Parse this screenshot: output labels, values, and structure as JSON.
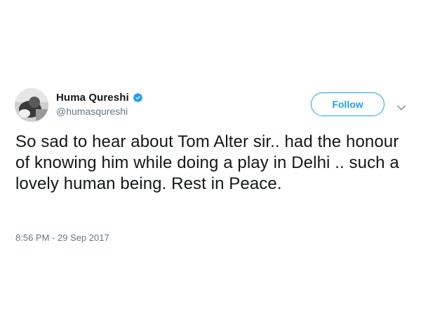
{
  "user": {
    "display_name": "Huma Qureshi",
    "handle": "@humasqureshi",
    "verified_icon": "verified-badge-icon",
    "avatar_icon": "profile-photo"
  },
  "follow_button": {
    "label": "Follow"
  },
  "menu_icon": "chevron-down-icon",
  "tweet": {
    "text": "So sad to hear about Tom Alter sir.. had the honour of knowing him while doing a play in Delhi .. such a lovely human being. Rest in Peace.",
    "timestamp": "8:56 PM - 29 Sep 2017"
  },
  "colors": {
    "accent": "#1da1f2",
    "text": "#14171a",
    "muted": "#657786"
  }
}
